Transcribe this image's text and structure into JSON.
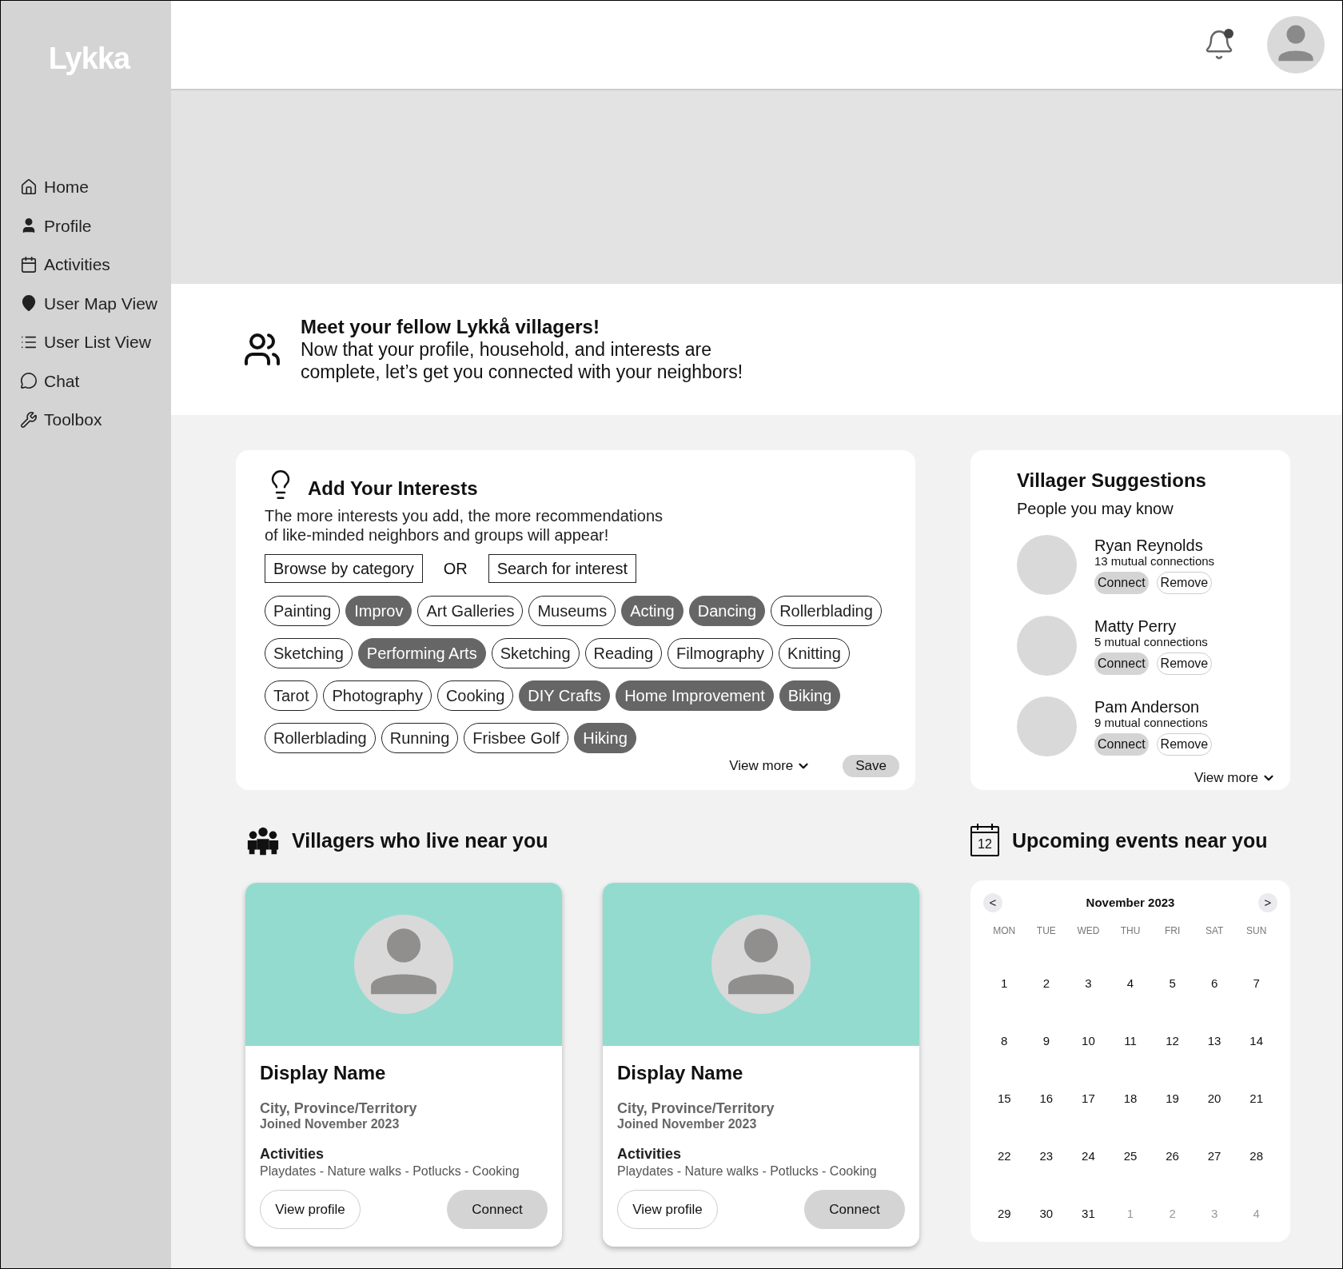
{
  "sidebar": {
    "logo": "Lykka",
    "items": [
      {
        "label": "Home",
        "kind": "home"
      },
      {
        "label": "Profile",
        "kind": "profile"
      },
      {
        "label": "Activities",
        "kind": "calendar"
      },
      {
        "label": "User Map View",
        "kind": "pin"
      },
      {
        "label": "User List View",
        "kind": "list"
      },
      {
        "label": "Chat",
        "kind": "chat"
      },
      {
        "label": "Toolbox",
        "kind": "wrench"
      }
    ]
  },
  "header": {
    "notification_dot": true
  },
  "intro": {
    "title": "Meet your fellow Lykkå villagers!",
    "lines": [
      "Now that your profile, household, and interests are",
      "complete, let’s get you connected with your neighbors!"
    ]
  },
  "interests": {
    "title": "Add Your Interests",
    "description": [
      "The more interests you add, the more recommendations",
      "of like-minded neighbors and groups will appear!"
    ],
    "browse": "Browse by category",
    "or": "OR",
    "search": "Search for interest",
    "chips": [
      {
        "label": "Painting",
        "selected": false
      },
      {
        "label": "Improv",
        "selected": true
      },
      {
        "label": "Art Galleries",
        "selected": false
      },
      {
        "label": "Museums",
        "selected": false
      },
      {
        "label": "Acting",
        "selected": true
      },
      {
        "label": "Dancing",
        "selected": true
      },
      {
        "label": "Rollerblading",
        "selected": false
      },
      {
        "label": "Sketching",
        "selected": false
      },
      {
        "label": "Performing Arts",
        "selected": true
      },
      {
        "label": "Sketching",
        "selected": false
      },
      {
        "label": "Reading",
        "selected": false
      },
      {
        "label": "Filmography",
        "selected": false
      },
      {
        "label": "Knitting",
        "selected": false
      },
      {
        "label": "Tarot",
        "selected": false
      },
      {
        "label": "Photography",
        "selected": false
      },
      {
        "label": "Cooking",
        "selected": false
      },
      {
        "label": "DIY Crafts",
        "selected": true
      },
      {
        "label": "Home Improvement",
        "selected": true
      },
      {
        "label": "Biking",
        "selected": true
      },
      {
        "label": "Rollerblading",
        "selected": false
      },
      {
        "label": "Running",
        "selected": false
      },
      {
        "label": "Frisbee Golf",
        "selected": false
      },
      {
        "label": "Hiking",
        "selected": true
      }
    ],
    "view_more": "View more",
    "save": "Save"
  },
  "suggestions": {
    "title": "Villager Suggestions",
    "subtitle": "People you may know",
    "people": [
      {
        "name": "Ryan Reynolds",
        "mutual": "13 mutual connections",
        "connect": "Connect",
        "remove": "Remove"
      },
      {
        "name": "Matty Perry",
        "mutual": "5 mutual connections",
        "connect": "Connect",
        "remove": "Remove"
      },
      {
        "name": "Pam Anderson",
        "mutual": "9 mutual connections",
        "connect": "Connect",
        "remove": "Remove"
      }
    ],
    "view_more": "View more"
  },
  "nearby": {
    "title": "Villagers who live near you",
    "cards": [
      {
        "name": "Display Name",
        "location": "City, Province/Territory",
        "joined": "Joined November 2023",
        "activities_label": "Activities",
        "activities": "Playdates - Nature walks - Potlucks - Cooking",
        "view_profile": "View profile",
        "connect": "Connect"
      },
      {
        "name": "Display Name",
        "location": "City, Province/Territory",
        "joined": "Joined November 2023",
        "activities_label": "Activities",
        "activities": "Playdates - Nature walks - Potlucks - Cooking",
        "view_profile": "View profile",
        "connect": "Connect"
      }
    ]
  },
  "events": {
    "title": "Upcoming events near you",
    "icon_day": "12",
    "calendar": {
      "prev": "<",
      "next": ">",
      "month": "November 2023",
      "weekdays": [
        "MON",
        "TUE",
        "WED",
        "THU",
        "FRI",
        "SAT",
        "SUN"
      ],
      "days": [
        {
          "label": "1",
          "muted": false
        },
        {
          "label": "2",
          "muted": false
        },
        {
          "label": "3",
          "muted": false
        },
        {
          "label": "4",
          "muted": false
        },
        {
          "label": "5",
          "muted": false
        },
        {
          "label": "6",
          "muted": false
        },
        {
          "label": "7",
          "muted": false
        },
        {
          "label": "8",
          "muted": false
        },
        {
          "label": "9",
          "muted": false
        },
        {
          "label": "10",
          "muted": false
        },
        {
          "label": "11",
          "muted": false
        },
        {
          "label": "12",
          "muted": false
        },
        {
          "label": "13",
          "muted": false
        },
        {
          "label": "14",
          "muted": false
        },
        {
          "label": "15",
          "muted": false
        },
        {
          "label": "16",
          "muted": false
        },
        {
          "label": "17",
          "muted": false
        },
        {
          "label": "18",
          "muted": false
        },
        {
          "label": "19",
          "muted": false
        },
        {
          "label": "20",
          "muted": false
        },
        {
          "label": "21",
          "muted": false
        },
        {
          "label": "22",
          "muted": false
        },
        {
          "label": "23",
          "muted": false
        },
        {
          "label": "24",
          "muted": false
        },
        {
          "label": "25",
          "muted": false
        },
        {
          "label": "26",
          "muted": false
        },
        {
          "label": "27",
          "muted": false
        },
        {
          "label": "28",
          "muted": false
        },
        {
          "label": "29",
          "muted": false
        },
        {
          "label": "30",
          "muted": false
        },
        {
          "label": "31",
          "muted": false
        },
        {
          "label": "1",
          "muted": true
        },
        {
          "label": "2",
          "muted": true
        },
        {
          "label": "3",
          "muted": true
        },
        {
          "label": "4",
          "muted": true
        }
      ]
    }
  }
}
